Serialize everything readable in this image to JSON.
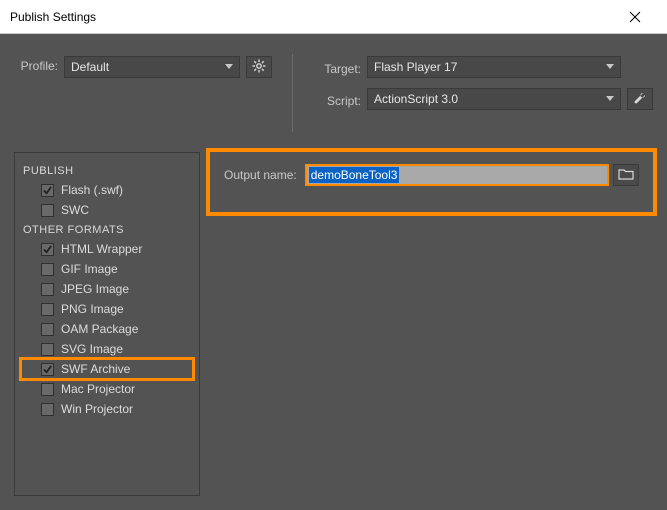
{
  "window": {
    "title": "Publish Settings"
  },
  "profile": {
    "label": "Profile:",
    "value": "Default"
  },
  "target": {
    "label": "Target:",
    "value": "Flash Player 17"
  },
  "script": {
    "label": "Script:",
    "value": "ActionScript 3.0"
  },
  "output": {
    "label": "Output name:",
    "value": "demoBoneTool3"
  },
  "sidebar": {
    "publish_heading": "PUBLISH",
    "other_heading": "OTHER FORMATS",
    "publish_items": [
      {
        "label": "Flash (.swf)",
        "checked": true
      },
      {
        "label": "SWC",
        "checked": false
      }
    ],
    "other_items": [
      {
        "label": "HTML Wrapper",
        "checked": true
      },
      {
        "label": "GIF Image",
        "checked": false
      },
      {
        "label": "JPEG Image",
        "checked": false
      },
      {
        "label": "PNG Image",
        "checked": false
      },
      {
        "label": "OAM Package",
        "checked": false
      },
      {
        "label": "SVG Image",
        "checked": false
      },
      {
        "label": "SWF Archive",
        "checked": true,
        "selected": true
      },
      {
        "label": "Mac Projector",
        "checked": false
      },
      {
        "label": "Win Projector",
        "checked": false
      }
    ]
  }
}
